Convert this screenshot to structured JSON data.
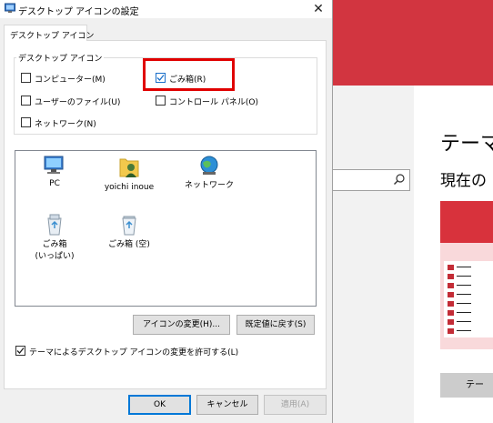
{
  "background_window": {
    "heading": "テーマ",
    "subheading": "現在の",
    "button_label": "テー",
    "accent_color": "#d23540"
  },
  "dialog": {
    "title": "デスクトップ アイコンの設定",
    "close_icon": "close-icon",
    "tab_label": "デスクトップ アイコン",
    "group_label": "デスクトップ アイコン",
    "checkboxes": [
      {
        "label": "コンピューター(M)",
        "checked": false
      },
      {
        "label": "ごみ箱(R)",
        "checked": true
      },
      {
        "label": "ユーザーのファイル(U)",
        "checked": false
      },
      {
        "label": "コントロール パネル(O)",
        "checked": false
      },
      {
        "label": "ネットワーク(N)",
        "checked": false
      }
    ],
    "icons": [
      {
        "label": "PC",
        "icon": "pc-icon"
      },
      {
        "label": "yoichi inoue",
        "icon": "user-folder-icon"
      },
      {
        "label": "ネットワーク",
        "icon": "network-icon"
      },
      {
        "label_line1": "ごみ箱",
        "label_line2": "(いっぱい)",
        "icon": "recycle-bin-full-icon"
      },
      {
        "label": "ごみ箱 (空)",
        "icon": "recycle-bin-empty-icon"
      }
    ],
    "change_icon_button": "アイコンの変更(H)...",
    "restore_default_button": "既定値に戻す(S)",
    "allow_themes_checkbox": {
      "label": "テーマによるデスクトップ アイコンの変更を許可する(L)",
      "checked": true
    },
    "ok_button": "OK",
    "cancel_button": "キャンセル",
    "apply_button": "適用(A)"
  }
}
